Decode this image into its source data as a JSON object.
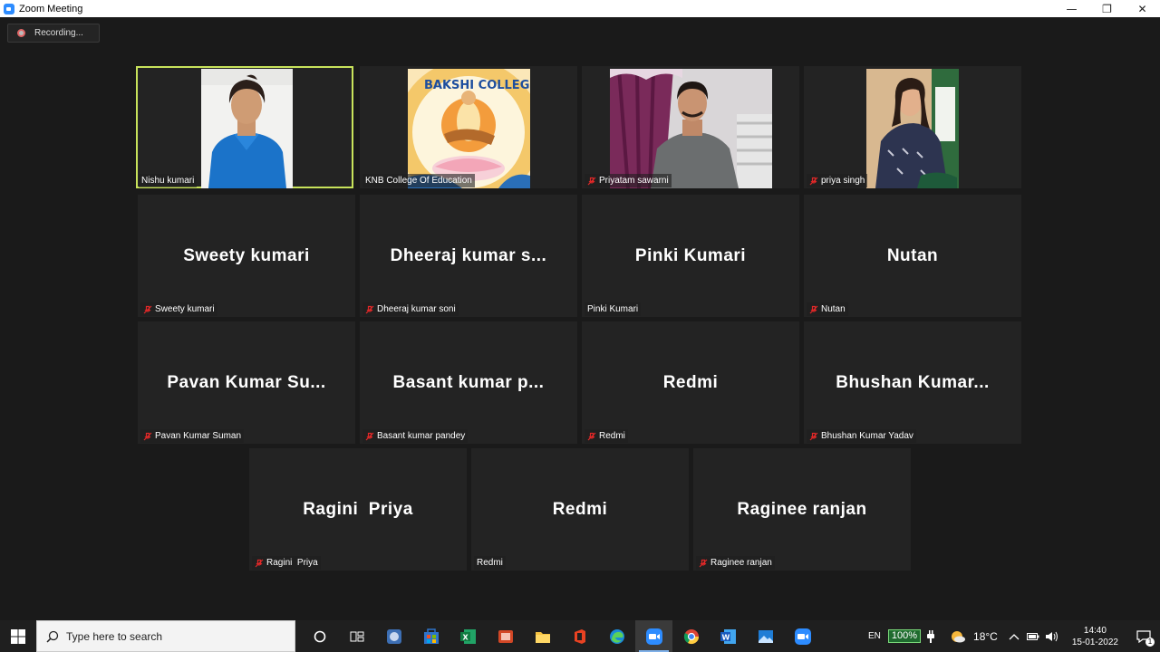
{
  "window": {
    "title": "Zoom Meeting",
    "controls": {
      "minimize": "—",
      "restore": "❐",
      "close": "✕"
    }
  },
  "recording": {
    "label": "Recording..."
  },
  "participants": [
    {
      "name": "Nishu kumari",
      "display": "",
      "video": true,
      "muted": false,
      "active": true
    },
    {
      "name": "KNB College Of Education",
      "display": "",
      "video": true,
      "muted": false,
      "active": false
    },
    {
      "name": "Priyatam sawarni",
      "display": "",
      "video": true,
      "muted": true,
      "active": false
    },
    {
      "name": "priya singh",
      "display": "",
      "video": true,
      "muted": true,
      "active": false
    },
    {
      "name": "Sweety kumari",
      "display": "Sweety kumari",
      "video": false,
      "muted": true,
      "active": false
    },
    {
      "name": "Dheeraj kumar soni",
      "display": "Dheeraj kumar s...",
      "video": false,
      "muted": true,
      "active": false
    },
    {
      "name": "Pinki Kumari",
      "display": "Pinki Kumari",
      "video": false,
      "muted": false,
      "active": false
    },
    {
      "name": "Nutan",
      "display": "Nutan",
      "video": false,
      "muted": true,
      "active": false
    },
    {
      "name": "Pavan Kumar Suman",
      "display": "Pavan Kumar Su...",
      "video": false,
      "muted": true,
      "active": false
    },
    {
      "name": "Basant kumar pandey",
      "display": "Basant kumar p...",
      "video": false,
      "muted": true,
      "active": false
    },
    {
      "name": "Redmi",
      "display": "Redmi",
      "video": false,
      "muted": true,
      "active": false
    },
    {
      "name": "Bhushan Kumar Yadav",
      "display": "Bhushan Kumar...",
      "video": false,
      "muted": true,
      "active": false
    },
    {
      "name": "Ragini  Priya",
      "display": "Ragini  Priya",
      "video": false,
      "muted": true,
      "active": false
    },
    {
      "name": "Redmi",
      "display": "Redmi",
      "video": false,
      "muted": false,
      "active": false
    },
    {
      "name": "Raginee ranjan",
      "display": "Raginee ranjan",
      "video": false,
      "muted": true,
      "active": false
    }
  ],
  "taskbar": {
    "search_placeholder": "Type here to search",
    "apps": [
      "cortana-icon",
      "task-view-icon",
      "snipping-tool-icon",
      "store-icon",
      "excel-icon",
      "presentation-icon",
      "file-explorer-icon",
      "office-icon",
      "edge-icon",
      "zoom-icon",
      "chrome-icon",
      "word-icon",
      "photos-icon",
      "zoom-icon"
    ],
    "active_app": "zoom-icon",
    "tray": {
      "language": "EN",
      "battery": "100%",
      "temperature": "18°C",
      "time": "14:40",
      "date": "15-01-2022",
      "notification_count": "1"
    }
  },
  "colors": {
    "active_speaker": "#c8e35b",
    "tile_bg": "#232323",
    "muted_icon": "#e02828"
  }
}
